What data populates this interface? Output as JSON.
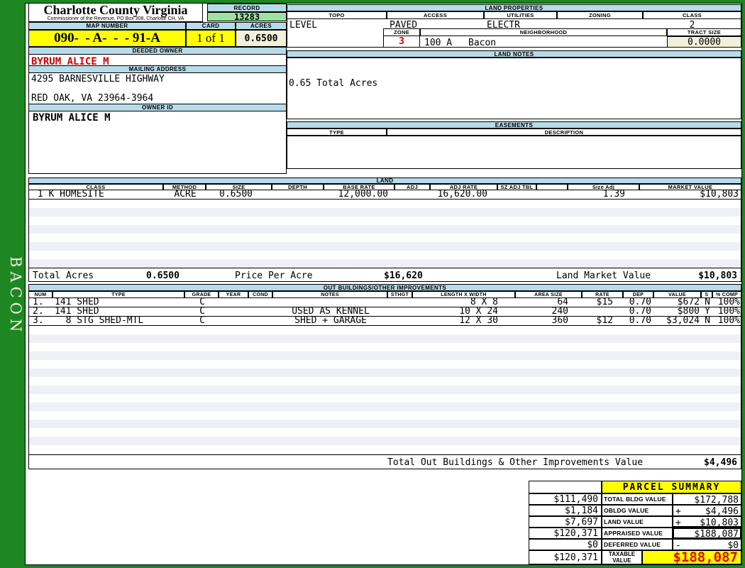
{
  "colors": {
    "green-border": "#1e8721",
    "section-header-blue": "#b7dbe8",
    "highlight-yellow": "#ffff00",
    "record-green": "#9fe29f",
    "cream": "#f2f0da",
    "stripe": "#eef0f6",
    "alert-red": "#cc0000",
    "taxable-red": "#e60000"
  },
  "sidebar": {
    "district": "BACON"
  },
  "header": {
    "county": "Charlotte County Virginia",
    "commissioner": "Commissioner of the Revenue, PO Box 308, Charlotte CH, VA",
    "record_label": "RECORD",
    "record_value": "13283",
    "map_number_label": "MAP NUMBER",
    "map_number_value": "090-  - A-  -  - 91-A",
    "card_label": "CARD",
    "card_value": "1 of 1",
    "acres_label": "ACRES",
    "acres_value": "0.6500"
  },
  "owner": {
    "deeded_owner_label": "DEEDED OWNER",
    "deeded_owner": "BYRUM ALICE M",
    "mailing_address_label": "MAILING ADDRESS",
    "address_line1": "4295 BARNESVILLE HIGHWAY",
    "address_line2": "RED OAK, VA 23964-3964",
    "owner_id_label": "OWNER ID",
    "owner_id": "BYRUM ALICE M"
  },
  "land_properties": {
    "title": "LAND PROPERTIES",
    "topo_label": "TOPO",
    "topo_value": "LEVEL",
    "access_label": "ACCESS",
    "access_value": "PAVED",
    "utilities_label": "UTILITIES",
    "utilities_value": "ELECTR",
    "zoning_label": "ZONING",
    "zoning_value": "",
    "class_label": "CLASS",
    "class_value": "2",
    "zone_label": "ZONE",
    "zone_value": "3",
    "neighborhood_label": "NEIGHBORHOOD",
    "neighborhood_code": "100 A",
    "neighborhood_name": "Bacon",
    "tract_size_label": "TRACT SIZE",
    "tract_size_value": "0.0000"
  },
  "land_notes": {
    "title": "LAND NOTES",
    "note": "0.65 Total Acres"
  },
  "easements": {
    "title": "EASEMENTS",
    "type_label": "TYPE",
    "description_label": "DESCRIPTION"
  },
  "land": {
    "title": "LAND",
    "headers": {
      "class": "CLASS",
      "method": "METHOD",
      "size": "SIZE",
      "depth": "DEPTH",
      "base_rate": "BASE RATE",
      "adj": "ADJ",
      "adj_rate": "ADJ RATE",
      "sz_adj_tbl": "SZ ADJ TBL",
      "size_adj": "Size Adj",
      "market_value": "MARKET VALUE"
    },
    "rows": [
      {
        "class": " 1 K HOMESITE",
        "method": "ACRE",
        "size": "0.6500",
        "depth": "",
        "base_rate": "12,000.00",
        "adj": "",
        "adj_rate": "16,620.00",
        "sz_adj_tbl": "",
        "size_adj": "1.39",
        "market_value": "$10,803"
      }
    ],
    "totals": {
      "total_acres_label": "Total Acres",
      "total_acres": "0.6500",
      "price_per_acre_label": "Price Per Acre",
      "price_per_acre": "$16,620",
      "land_market_value_label": "Land Market Value",
      "land_market_value": "$10,803"
    }
  },
  "outbuildings": {
    "title": "OUT BUILDINGS/OTHER IMPROVEMENTS",
    "headers": {
      "num": "NUM",
      "type": "TYPE",
      "grade": "GRADE",
      "year": "YEAR",
      "cond": "COND",
      "notes": "NOTES",
      "sthgt": "STHGT",
      "length_width": "LENGTH X WIDTH",
      "area_size": "AREA SIZE",
      "rate": "RATE",
      "dep": "DEP",
      "value": "VALUE",
      "s": "S",
      "pct_comp": "% COMP"
    },
    "rows": [
      {
        "num": "1.",
        "type": "141 SHED",
        "grade": "C",
        "year": "",
        "cond": "",
        "notes": "",
        "sthgt": "",
        "length_width": "8 X 8",
        "area_size": "64",
        "rate": "$15",
        "dep": "0.70",
        "value": "$672",
        "s": "N",
        "pct_comp": "100%"
      },
      {
        "num": "2.",
        "type": "141 SHED",
        "grade": "C",
        "year": "",
        "cond": "",
        "notes": "USED AS KENNEL",
        "sthgt": "",
        "length_width": "10 X 24",
        "area_size": "240",
        "rate": "",
        "dep": "0.70",
        "value": "$800",
        "s": "Y",
        "pct_comp": "100%"
      },
      {
        "num": "3.",
        "type": "  8 STG SHED-MTL",
        "grade": "C",
        "year": "",
        "cond": "",
        "notes": "SHED + GARAGE",
        "sthgt": "",
        "length_width": "12 X 30",
        "area_size": "360",
        "rate": "$12",
        "dep": "0.70",
        "value": "$3,024",
        "s": "N",
        "pct_comp": "100%"
      }
    ],
    "total_label": "Total Out Buildings & Other Improvements Value",
    "total_value": "$4,496"
  },
  "parcel_summary": {
    "title": "PARCEL SUMMARY",
    "rows": [
      {
        "prior": "$111,490",
        "label": "TOTAL BLDG VALUE",
        "sign": "",
        "value": "$172,788"
      },
      {
        "prior": "$1,184",
        "label": "OBLDG VALUE",
        "sign": "+",
        "value": "$4,496"
      },
      {
        "prior": "$7,697",
        "label": "LAND VALUE",
        "sign": "+",
        "value": "$10,803"
      },
      {
        "prior": "$120,371",
        "label": "APPRAISED VALUE",
        "sign": "",
        "value": "$188,087"
      },
      {
        "prior": "$0",
        "label": "DEFERRED VALUE",
        "sign": "-",
        "value": "$0"
      }
    ],
    "taxable": {
      "prior": "$120,371",
      "label": "TAXABLE VALUE",
      "value": "$188,087"
    }
  }
}
